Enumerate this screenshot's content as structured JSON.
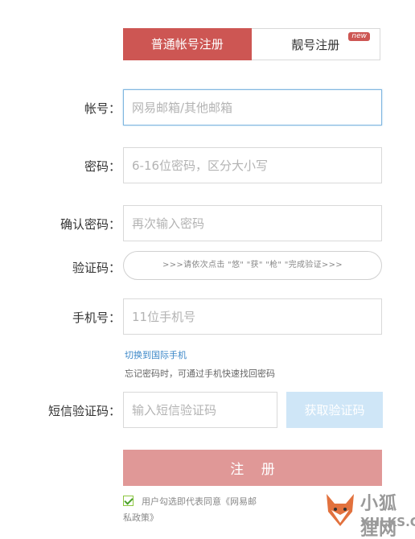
{
  "tabs": {
    "normal": "普通帐号注册",
    "vip": "靓号注册",
    "vip_badge": "new"
  },
  "form": {
    "account": {
      "label": "帐号：",
      "placeholder": "网易邮箱/其他邮箱"
    },
    "password": {
      "label": "密码：",
      "placeholder": "6-16位密码，区分大小写"
    },
    "confirm": {
      "label": "确认密码：",
      "placeholder": "再次输入密码"
    },
    "captcha": {
      "label": "验证码：",
      "text": ">>>请依次点击 \"悠\" \"获\" \"枪\" \"完成验证>>>"
    },
    "phone": {
      "label": "手机号：",
      "placeholder": "11位手机号"
    },
    "switch_intl": "切换到国际手机",
    "phone_hint": "忘记密码时，可通过手机快速找回密码",
    "sms": {
      "label": "短信验证码：",
      "placeholder": "输入短信验证码",
      "button": "获取验证码"
    },
    "submit": "注 册",
    "agreement": "用户勾选即代表同意《网易邮",
    "agreement_tail": "私政策》"
  },
  "watermark": {
    "title": "小狐狸网",
    "subtitle": "XHLKS.CN"
  },
  "colors": {
    "primary": "#cd5653",
    "submit_disabled": "#e09897",
    "sms_disabled": "#cfe6f7",
    "link": "#3b87c8",
    "focus_border": "#7fb6e0"
  }
}
